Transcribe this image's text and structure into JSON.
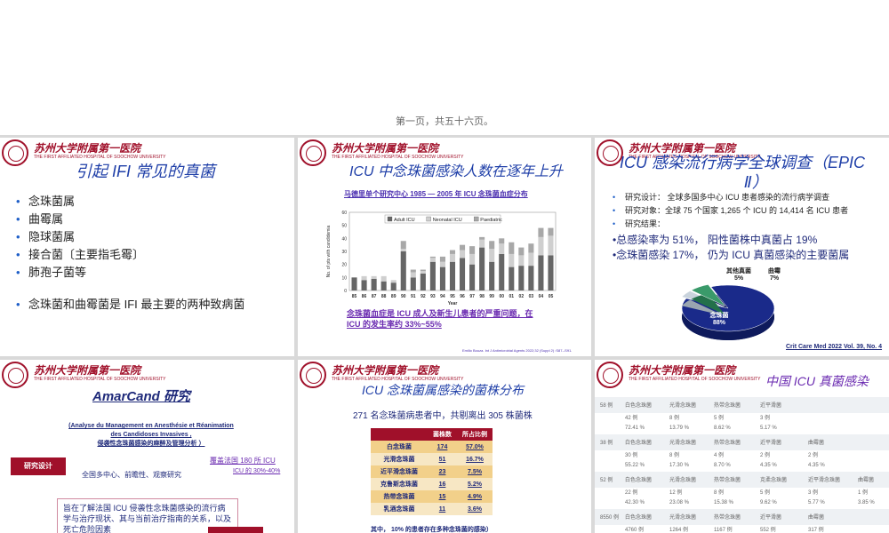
{
  "pager": "第一页，共五十六页。",
  "colors": {
    "title_blue": "#1f3fa8",
    "brand_red": "#a0102a",
    "navy": "#1f2a7a",
    "purple": "#6a2ab0"
  },
  "logo": {
    "cn": "苏州大学附属第一医院",
    "en": "THE FIRST AFFILIATED HOSPITAL OF SOOCHOW UNIVERSITY"
  },
  "s1": {
    "title": "引起 IFI 常见的真菌",
    "items": [
      "念珠菌属",
      "曲霉属",
      "隐球菌属",
      "接合菌〔主要指毛霉〕",
      "肺孢子菌等"
    ],
    "conclusion": "念珠菌和曲霉菌是 IFI 最主要的两种致病菌"
  },
  "s2": {
    "title": "ICU 中念珠菌感染人数在逐年上升",
    "subtitle": "马德里单个研究中心 1985 — 2005 年 ICU 念珠菌血症分布",
    "note": "念珠菌血症是 ICU 成人及新生儿患者的严重问题，在 ICU 的发生率约 33%~55%",
    "cite": "Emilio Bouza. Int J Antimicrobial Agents 2022;32 (Suppl 2) :S87--S91.",
    "chart_data": {
      "type": "bar",
      "categories": [
        "85",
        "86",
        "87",
        "88",
        "89",
        "90",
        "91",
        "92",
        "93",
        "94",
        "95",
        "96",
        "97",
        "98",
        "99",
        "00",
        "01",
        "02",
        "03",
        "04",
        "05"
      ],
      "series": [
        {
          "name": "Adult ICU",
          "values": [
            10,
            8,
            9,
            7,
            6,
            30,
            10,
            13,
            22,
            18,
            22,
            25,
            20,
            33,
            22,
            28,
            18,
            19,
            19,
            27,
            27
          ]
        },
        {
          "name": "Neonatal ICU",
          "values": [
            0,
            3,
            2,
            4,
            2,
            2,
            4,
            2,
            3,
            4,
            6,
            6,
            8,
            6,
            10,
            8,
            10,
            8,
            10,
            14,
            15
          ]
        },
        {
          "name": "Paediatric",
          "values": [
            0,
            0,
            0,
            0,
            0,
            6,
            2,
            1,
            1,
            4,
            3,
            4,
            6,
            2,
            6,
            4,
            9,
            6,
            7,
            7,
            6
          ]
        }
      ],
      "ylabel": "No. of pts with candidemia",
      "xlabel": "Year",
      "ylim": [
        0,
        60
      ],
      "yticks": [
        "0",
        "10",
        "20",
        "30",
        "40",
        "50",
        "60"
      ]
    }
  },
  "s3": {
    "title_line1": "ICU 感染流行病学全球调查（EPIC",
    "title_line2": "Ⅱ）",
    "bullets": [
      "研究设计：  全球多国多中心 ICU 患者感染的流行病学调查",
      "研究对象：全球 75 个国家 1,265 个 ICU 的 14,414 名 ICU 患者",
      "研究结果："
    ],
    "result1": "•总感染率为 51%， 阳性菌株中真菌占 19%",
    "result2": "•念珠菌感染 17%，  仍为 ICU 真菌感染的主要菌属",
    "chart_data": {
      "type": "pie",
      "slices": [
        {
          "name": "念珠菌",
          "value": 88,
          "label": "88%"
        },
        {
          "name": "其他真菌",
          "value": 5,
          "label": "5%"
        },
        {
          "name": "曲霉",
          "value": 7,
          "label": "7%"
        }
      ]
    },
    "cite": "Crit Care Med 2022 Vol. 39, No. 4"
  },
  "s4": {
    "title": "AmarCand 研究",
    "subtitle_l1": "(Analyse du Management en Anesthésie et Réanimation",
    "subtitle_l2": "des Candidoses Invasives ,",
    "subtitle_l3": "侵袭性念珠菌感染的麻醉及管理分析 ）",
    "design_label": "研究设计",
    "design_text": "全国多中心、前瞻性、观察研究",
    "scope": "覆盖法国 180 所 ICU",
    "scope2": "ICU 的 30%-40%",
    "aim": "旨在了解法国 ICU 侵袭性念珠菌感染的流行病学与治疗现状、其与当前治疗指南的关系，以及死亡危险因素"
  },
  "s5": {
    "title": "ICU 念珠菌属感染的菌株分布",
    "subtitle": "271 名念珠菌病患者中，共剔离出 305 株菌株",
    "headers": [
      "",
      "菌株数",
      "所占比例"
    ],
    "rows": [
      [
        "白念珠菌",
        "174",
        "57.0%"
      ],
      [
        "光滑念珠菌",
        "51",
        "16.7%"
      ],
      [
        "近平滑念珠菌",
        "23",
        "7.5%"
      ],
      [
        "克鲁斯念珠菌",
        "16",
        "5.2%"
      ],
      [
        "热带念珠菌",
        "15",
        "4.9%"
      ],
      [
        "乳酒念珠菌",
        "11",
        "3.6%"
      ]
    ],
    "footnote": "其中，  10% 的患者存在多种念珠菌的感染）"
  },
  "s6": {
    "title": "中国 ICU 真菌感染",
    "rows": [
      {
        "c": [
          "58 例",
          "白色念珠菌",
          "光滑念珠菌",
          "热带念珠菌",
          "近平滑菌",
          ""
        ]
      },
      {
        "c": [
          "",
          "42 例",
          "8 例",
          "5 例",
          "3 例",
          ""
        ]
      },
      {
        "c": [
          "",
          "72.41 %",
          "13.79 %",
          "8.62 %",
          "5.17 %",
          ""
        ]
      },
      {
        "c": [
          "38 例",
          "白色念珠菌",
          "光滑念珠菌",
          "热带念珠菌",
          "近平滑菌",
          "曲霉菌"
        ]
      },
      {
        "c": [
          "",
          "30 例",
          "8 例",
          "4 例",
          "2 例",
          "2 例"
        ]
      },
      {
        "c": [
          "",
          "55.22 %",
          "17.30 %",
          "8.70 %",
          "4.35 %",
          "4.35 %"
        ]
      },
      {
        "c": [
          "52 例",
          "白色念珠菌",
          "光滑念珠菌",
          "热带念珠菌",
          "克柔念珠菌",
          "近平滑念珠菌"
        ]
      },
      {
        "c": [
          "",
          "22 例",
          "12 例",
          "8 例",
          "5 例",
          "3 例"
        ]
      },
      {
        "c": [
          "",
          "42.30 %",
          "23.08 %",
          "15.38 %",
          "9.62 %",
          "5.77 %"
        ]
      },
      {
        "c": [
          "8550 例",
          "白色念珠菌",
          "光滑念珠菌",
          "热带念珠菌",
          "近平滑菌",
          "曲霉菌"
        ]
      },
      {
        "c": [
          "",
          "4760 例",
          "1264 例",
          "1167 例",
          "552 例",
          "317 例"
        ]
      }
    ],
    "extra": [
      "曲霉菌",
      "1 例",
      "3.85 %"
    ]
  }
}
